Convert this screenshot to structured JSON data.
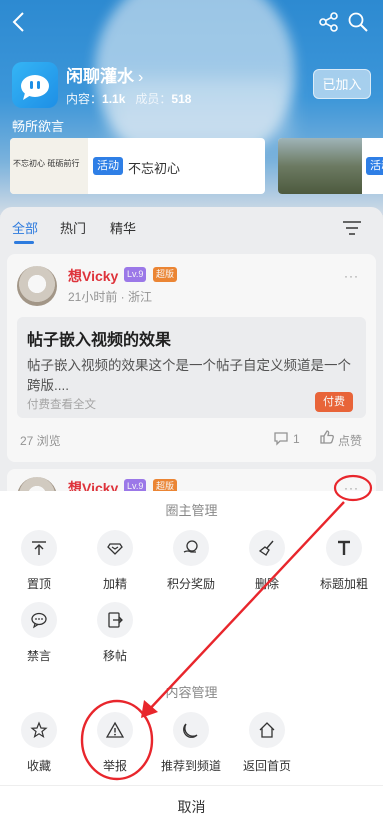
{
  "circle": {
    "name": "闲聊灌水",
    "stats_content_label": "内容：",
    "stats_content_value": "1.1k",
    "stats_members_label": "成员：",
    "stats_members_value": "518",
    "join_label": "已加入",
    "slogan": "畅所欲言"
  },
  "activities": [
    {
      "badge": "活动",
      "title": "不忘初心",
      "thumb_text": "不忘初心  砥砺前行"
    },
    {
      "badge": "活动"
    }
  ],
  "tabs": [
    "全部",
    "热门",
    "精华"
  ],
  "post": {
    "author": "想Vicky",
    "level": "Lv.9",
    "role": "超版",
    "meta": "21小时前 · 浙江",
    "title": "帖子嵌入视频的效果",
    "excerpt": "帖子嵌入视频的效果这个是一个帖子自定义频道是一个跨版....",
    "paywall": "付费查看全文",
    "pay_badge": "付费",
    "views": "27 浏览",
    "comments": "1",
    "like_label": "点赞",
    "more": "···"
  },
  "post2": {
    "author": "想Vicky",
    "level": "Lv.9",
    "role": "超版",
    "more": "···"
  },
  "sheet": {
    "owner_title": "圈主管理",
    "owner_actions": [
      "置顶",
      "加精",
      "积分奖励",
      "删除",
      "标题加粗",
      "禁言",
      "移帖"
    ],
    "content_title": "内容管理",
    "content_actions": [
      "收藏",
      "举报",
      "推荐到频道",
      "返回首页"
    ],
    "cancel_label": "取消"
  },
  "colors": {
    "accent": "#2f7fe6",
    "annotation": "#e8262c",
    "author": "#e6353d"
  }
}
